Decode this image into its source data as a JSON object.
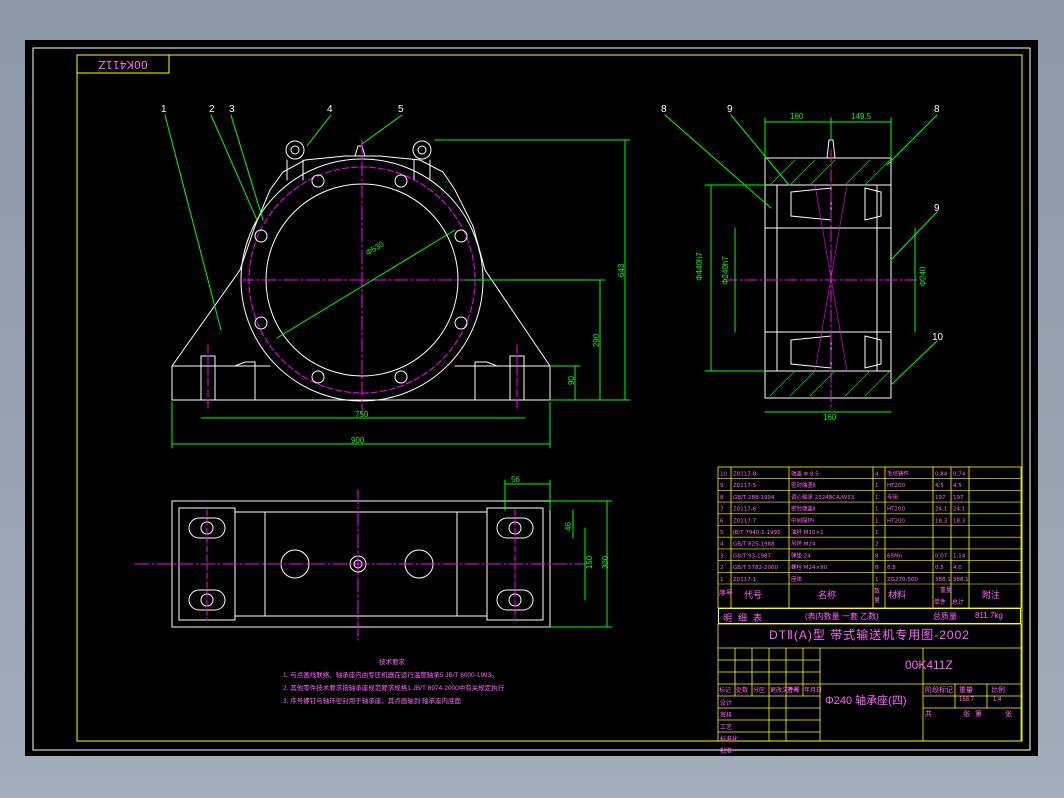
{
  "drawing": {
    "flipped_code": "00K411Z",
    "colors": {
      "frame": "#ffff00",
      "dim": "#00ff00",
      "part": "#ffffff",
      "center": "#ff00ff",
      "table": "#ffff00",
      "text_magenta": "#ff66ff"
    },
    "front_view": {
      "balloons": [
        "1",
        "2",
        "3",
        "4",
        "5"
      ],
      "dims": {
        "bore": "Φ530",
        "height_total": "643",
        "height_center": "290",
        "base_h": "90",
        "bolt_span": "750",
        "length": "900"
      }
    },
    "side_view": {
      "balloons": [
        "8",
        "9",
        "8",
        "9",
        "10"
      ],
      "dims": {
        "w1": "160",
        "w2": "149.5",
        "w3": "160",
        "d_outer": "Φ440h7",
        "d_bore": "Φ240h7",
        "d_shaft": "Φ240"
      }
    },
    "top_view": {
      "dims": {
        "a": "56",
        "b": "46",
        "c": "150",
        "d": "300"
      }
    },
    "notes": {
      "heading": "技术要求",
      "lines": [
        "1. 与点画线联络，轴承座内由专压机器在运行温度轴承5 JB/T 8000-1993。",
        "2. 其他零件技术要求按轴承座规范要求规格1 JB/T 8974-2000中有关规定执行",
        "3. 序号螺钉与轴环密封用于轴承座，其点画轴到 轴承座内底面"
      ]
    },
    "bom": {
      "rows": [
        [
          "10",
          "Z0117-8",
          "端盖 Φ 8.5",
          "4",
          "毛坯铸件",
          "0.84",
          "0.74"
        ],
        [
          "9",
          "Z0117-5",
          "密封端盖Ⅱ",
          "1",
          "HT200",
          "4.5",
          "4.5"
        ],
        [
          "8",
          "GB/T 288-1994",
          "调心轴承 23248CA/W33",
          "1",
          "专用",
          "197",
          "197"
        ],
        [
          "7",
          "Z0117-6",
          "密封端盖Ⅱ",
          "1",
          "HT200",
          "24.1",
          "24.1"
        ],
        [
          "6",
          "Z0117-7",
          "中间隔环Ⅰ",
          "1",
          "HT200",
          "18.3",
          "18.3"
        ],
        [
          "5",
          "JB/T 7940.1-1995",
          "油杯 M10×1",
          "1",
          "",
          "",
          ""
        ],
        [
          "4",
          "GB/T 825-1988",
          "吊环 M24",
          "2",
          "",
          "",
          ""
        ],
        [
          "3",
          "GB/T 93-1987",
          "弹垫 24",
          "8",
          "65Mn",
          "0.07",
          "1.14"
        ],
        [
          "2",
          "GB/T 5782-2000",
          "螺栓 M24×90",
          "8",
          "8.8",
          "0.5",
          "4.0"
        ],
        [
          "1",
          "Z0117-1",
          "座体",
          "1",
          "ZG270-500",
          "388.1",
          "388.1"
        ]
      ],
      "header_labels": [
        "序号",
        "代号",
        "名称",
        "数量",
        "材料",
        "单件",
        "总计",
        "附注"
      ],
      "header_qty": "数量",
      "header_weight": "重量",
      "title_left": "明细表",
      "subtitle": "(表内数量   一套   乙数)",
      "total_label": "总质量",
      "total_value": "811.7kg",
      "series_title": "DTⅡ(A)型  带式输送机专用图-2002"
    },
    "title_block": {
      "code": "00K411Z",
      "part_name": "Φ240 轴承座(四)",
      "weight_small": "168.7",
      "scale_small": "1:4",
      "row_labels": [
        "标记",
        "处数",
        "分区",
        "更改文件号",
        "签名",
        "年月日"
      ],
      "sign_labels": [
        "设计",
        "审核",
        "工艺",
        "标准化",
        "批准"
      ],
      "right_labels": [
        "阶段标记",
        "重量",
        "比例"
      ],
      "sheet_labels": [
        "共",
        "张",
        "第",
        "张"
      ]
    }
  }
}
